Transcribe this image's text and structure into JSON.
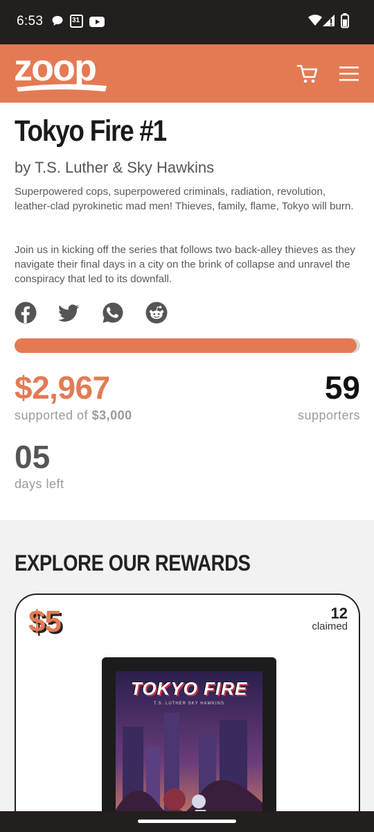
{
  "status_bar": {
    "time": "6:53",
    "calendar_day": "31"
  },
  "app": {
    "logo_text": "zoop",
    "brand_color": "#e47a53"
  },
  "campaign": {
    "title": "Tokyo Fire #1",
    "byline": "by T.S. Luther & Sky Hawkins",
    "description": [
      "Superpowered cops, superpowered criminals, radiation, revolution, leather-clad pyrokinetic mad men! Thieves, family, flame, Tokyo will burn.",
      "Join us in kicking off the series that follows two back-alley thieves as they navigate their final days in a city on the brink of collapse and unravel the conspiracy that led to its downfall."
    ],
    "share_icons": [
      "facebook-icon",
      "twitter-icon",
      "whatsapp-icon",
      "reddit-icon"
    ],
    "progress_fraction": 0.989,
    "raised": "$2,967",
    "supported_of_prefix": "supported of",
    "goal": "$3,000",
    "supporters_count": "59",
    "supporters_label": "supporters",
    "days_left": "05",
    "days_left_label": "days left"
  },
  "rewards": {
    "heading": "EXPLORE OUR REWARDS",
    "items": [
      {
        "price": "$5",
        "claimed_count": "12",
        "claimed_label": "claimed",
        "cover_title": "TOKYO FIRE",
        "cover_credits": "T.S. LUTHER   SKY HAWKINS"
      }
    ]
  }
}
